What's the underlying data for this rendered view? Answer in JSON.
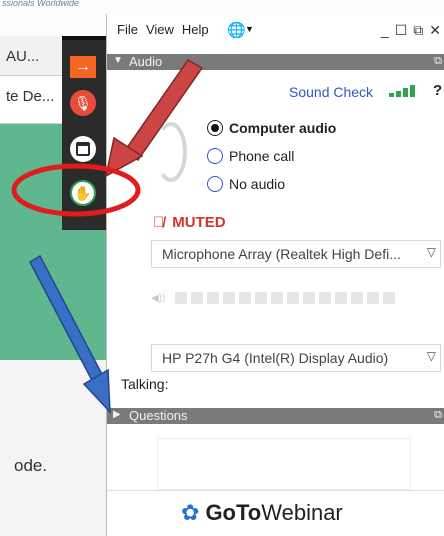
{
  "background": {
    "header_text": "ssionals Worldwide",
    "tab1": "AU...",
    "tab2": "te De...",
    "mode_text": "ode."
  },
  "toolbar": {
    "buttons": [
      {
        "icon": "arrow-right-icon"
      },
      {
        "icon": "mic-muted-icon"
      },
      {
        "icon": "panel-icon"
      },
      {
        "icon": "raise-hand-icon"
      }
    ]
  },
  "menubar": {
    "items": [
      "File",
      "View",
      "Help"
    ],
    "language_icon": "globe-icon"
  },
  "audio": {
    "section_title": "Audio",
    "sound_check": "Sound Check",
    "help": "?",
    "options": [
      "Computer audio",
      "Phone call",
      "No audio"
    ],
    "selected_option": "Computer audio",
    "status": "MUTED",
    "microphone": "Microphone Array (Realtek High Defi...",
    "speaker": "HP P27h G4 (Intel(R) Display Audio)",
    "talking_label": "Talking:"
  },
  "questions": {
    "section_title": "Questions"
  },
  "branding": {
    "bold": "GoTo",
    "rest": "Webinar"
  },
  "colors": {
    "accent_blue": "#2a5bbf",
    "muted_red": "#d0342c",
    "annotation_red": "#e21c1c",
    "annotation_blue": "#3a6fc6"
  }
}
